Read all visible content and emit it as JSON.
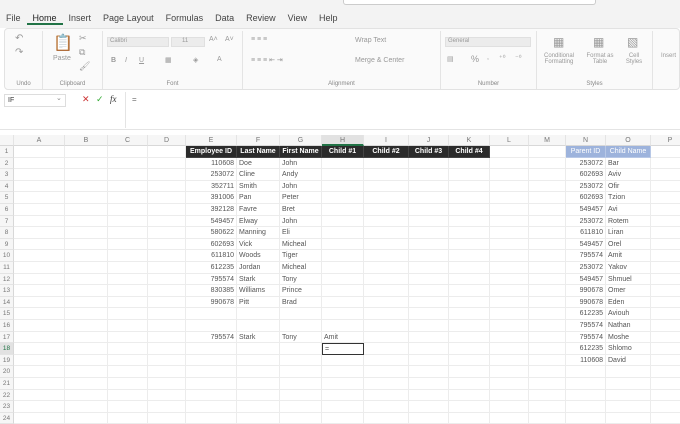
{
  "menu": [
    "File",
    "Home",
    "Insert",
    "Page Layout",
    "Formulas",
    "Data",
    "Review",
    "View",
    "Help"
  ],
  "ribbon": {
    "groups": [
      "Undo",
      "Clipboard",
      "Font",
      "Alignment",
      "Number",
      "Styles"
    ],
    "paste": "Paste",
    "font_name": "Calibri",
    "font_size": "11",
    "wrap_text": "Wrap Text",
    "merge_center": "Merge & Center",
    "number_format": "General",
    "conditional_formatting": "Conditional Formatting",
    "format_as_table": "Format as Table",
    "cell_styles": "Cell Styles",
    "insert": "Insert",
    "bold": "B",
    "italic": "I",
    "underline": "U",
    "percent": "%"
  },
  "formula_bar": {
    "name_box": "IF",
    "formula": "=",
    "cancel": "✕",
    "enter": "✓",
    "fx": "fx"
  },
  "columns": [
    "A",
    "B",
    "C",
    "D",
    "E",
    "F",
    "G",
    "H",
    "I",
    "J",
    "K",
    "L",
    "M",
    "N",
    "O",
    "P"
  ],
  "active_cell": {
    "col": "H",
    "row": 18,
    "value": "="
  },
  "employees": {
    "headers": [
      "Employee ID",
      "Last Name",
      "First Name",
      "Child #1",
      "Child #2",
      "Child #3",
      "Child #4"
    ],
    "rows": [
      [
        "110608",
        "Doe",
        "John"
      ],
      [
        "253072",
        "Cline",
        "Andy"
      ],
      [
        "352711",
        "Smith",
        "John"
      ],
      [
        "391006",
        "Pan",
        "Peter"
      ],
      [
        "392128",
        "Favre",
        "Bret"
      ],
      [
        "549457",
        "Elway",
        "John"
      ],
      [
        "580622",
        "Manning",
        "Eli"
      ],
      [
        "602693",
        "Vick",
        "Micheal"
      ],
      [
        "611810",
        "Woods",
        "Tiger"
      ],
      [
        "612235",
        "Jordan",
        "Micheal"
      ],
      [
        "795574",
        "Stark",
        "Tony"
      ],
      [
        "830385",
        "Williams",
        "Prince"
      ],
      [
        "990678",
        "Pitt",
        "Brad"
      ]
    ],
    "lookup_row": [
      "795574",
      "Stark",
      "Tony",
      "Amit"
    ]
  },
  "children": {
    "headers": [
      "Parent ID",
      "Child Name"
    ],
    "rows": [
      [
        "253072",
        "Bar"
      ],
      [
        "602693",
        "Aviv"
      ],
      [
        "253072",
        "Ofir"
      ],
      [
        "602693",
        "Tzion"
      ],
      [
        "549457",
        "Avi"
      ],
      [
        "253072",
        "Rotem"
      ],
      [
        "611810",
        "Liran"
      ],
      [
        "549457",
        "Orel"
      ],
      [
        "795574",
        "Amit"
      ],
      [
        "253072",
        "Yakov"
      ],
      [
        "549457",
        "Shmuel"
      ],
      [
        "990678",
        "Omer"
      ],
      [
        "990678",
        "Eden"
      ],
      [
        "612235",
        "Aviouh"
      ],
      [
        "795574",
        "Nathan"
      ],
      [
        "795574",
        "Moshe"
      ],
      [
        "612235",
        "Shlomo"
      ],
      [
        "110608",
        "David"
      ]
    ]
  }
}
